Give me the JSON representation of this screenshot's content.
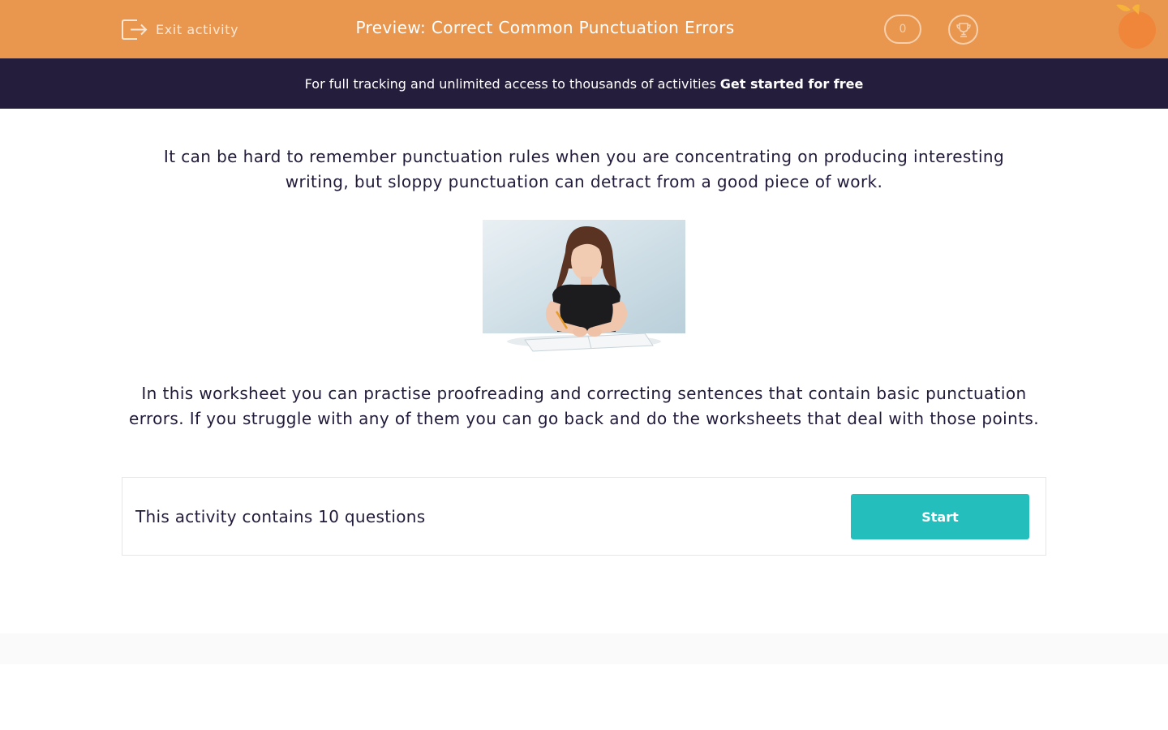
{
  "header": {
    "exit_label": "Exit activity",
    "title": "Preview: Correct Common Punctuation Errors",
    "score": "0",
    "trophy_icon": "trophy-icon",
    "logo_icon": "orange-logo",
    "bg_color": "#e9974f"
  },
  "promo": {
    "text": "For full tracking and unlimited access to thousands of activities",
    "link": "Get started for free",
    "bg_color": "#251d3c"
  },
  "intro": {
    "text": "It can be hard to remember punctuation rules when you are concentrating on producing interesting writing, but sloppy punctuation can detract from a good piece of work."
  },
  "image": {
    "subject": "girl writing in notebook at desk"
  },
  "description": {
    "text": "In this worksheet you can practise proofreading and correcting sentences that contain basic punctuation errors. If you struggle with any of them you can go back and do the worksheets that deal with those points."
  },
  "activity": {
    "count_text": "This activity contains 10 questions",
    "start_label": "Start",
    "button_color": "#24bfbd"
  }
}
